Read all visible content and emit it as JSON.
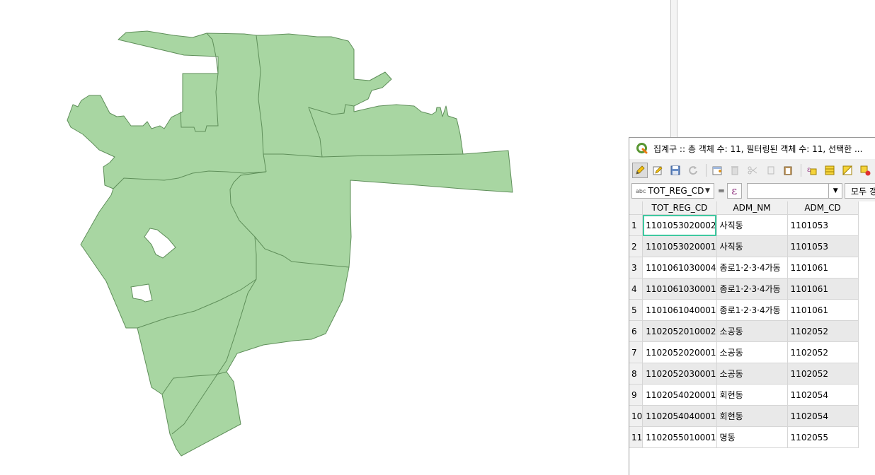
{
  "window": {
    "title": "집계구 :: 총 객체 수: 11, 필터링된 객체 수: 11, 선택한 ..."
  },
  "toolbar": {
    "icons": [
      "pencil-icon",
      "multi-edit-icon",
      "save-icon",
      "reload-icon",
      "add-feature-icon",
      "delete-icon",
      "cut-icon",
      "copy-icon",
      "paste-icon",
      "expression-select-icon",
      "select-all-icon",
      "invert-selection-icon",
      "deselect-icon"
    ]
  },
  "filter": {
    "field_type": "abc",
    "field_name": "TOT_REG_CD",
    "equals": "=",
    "expression_symbol": "ε",
    "value": "",
    "select_all_label": "모두 갱"
  },
  "table": {
    "columns": [
      "TOT_REG_CD",
      "ADM_NM",
      "ADM_CD"
    ],
    "rows": [
      {
        "n": "1",
        "tot_reg_cd": "1101053020002",
        "adm_nm": "사직동",
        "adm_cd": "1101053"
      },
      {
        "n": "2",
        "tot_reg_cd": "1101053020001",
        "adm_nm": "사직동",
        "adm_cd": "1101053"
      },
      {
        "n": "3",
        "tot_reg_cd": "1101061030004",
        "adm_nm": "종로1·2·3·4가동",
        "adm_cd": "1101061"
      },
      {
        "n": "4",
        "tot_reg_cd": "1101061030001",
        "adm_nm": "종로1·2·3·4가동",
        "adm_cd": "1101061"
      },
      {
        "n": "5",
        "tot_reg_cd": "1101061040001",
        "adm_nm": "종로1·2·3·4가동",
        "adm_cd": "1101061"
      },
      {
        "n": "6",
        "tot_reg_cd": "1102052010002",
        "adm_nm": "소공동",
        "adm_cd": "1102052"
      },
      {
        "n": "7",
        "tot_reg_cd": "1102052020001",
        "adm_nm": "소공동",
        "adm_cd": "1102052"
      },
      {
        "n": "8",
        "tot_reg_cd": "1102052030001",
        "adm_nm": "소공동",
        "adm_cd": "1102052"
      },
      {
        "n": "9",
        "tot_reg_cd": "1102054020001",
        "adm_nm": "회현동",
        "adm_cd": "1102054"
      },
      {
        "n": "10",
        "tot_reg_cd": "1102054040001",
        "adm_nm": "회현동",
        "adm_cd": "1102054"
      },
      {
        "n": "11",
        "tot_reg_cd": "1102055010001",
        "adm_nm": "명동",
        "adm_cd": "1102055"
      }
    ]
  },
  "colors": {
    "polygon_fill": "#a8d6a2",
    "polygon_stroke": "#5f8f5a",
    "focus_outline": "#3ec8a0",
    "alt_row": "#e9e9e9"
  }
}
